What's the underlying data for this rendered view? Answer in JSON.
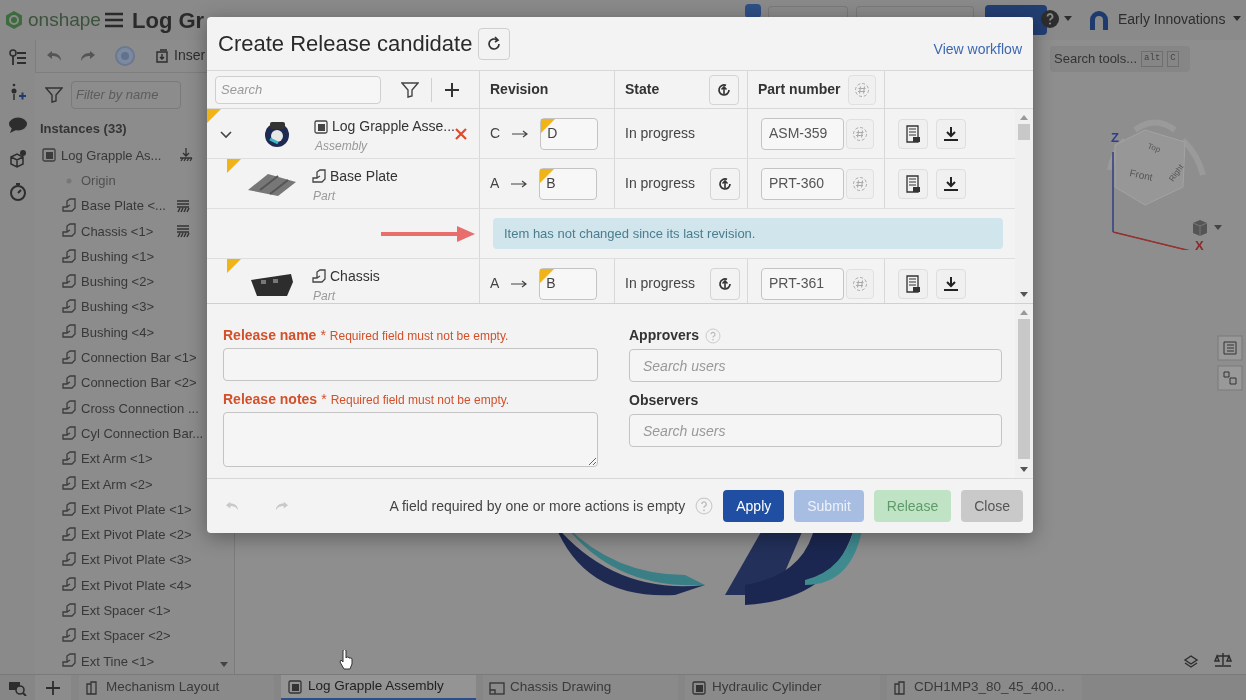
{
  "app": {
    "logo": "onshape",
    "document_title": "Log Gr",
    "user": "Early Innovations"
  },
  "toolbar": {
    "insert_label": "Inser"
  },
  "sidebar": {
    "filter_placeholder": "Filter by name",
    "heading": "Instances (33)",
    "items": [
      {
        "label": "Log Grapple As...",
        "kind": "assembly",
        "fixed": true,
        "children": [
          {
            "label": "Origin",
            "kind": "origin",
            "fixed": false
          },
          {
            "label": "Base Plate <...",
            "kind": "part",
            "fixed": true
          },
          {
            "label": "Chassis <1>",
            "kind": "part",
            "fixed": true
          },
          {
            "label": "Bushing <1>",
            "kind": "part",
            "fixed": false
          },
          {
            "label": "Bushing <2>",
            "kind": "part",
            "fixed": false
          },
          {
            "label": "Bushing <3>",
            "kind": "part",
            "fixed": false
          },
          {
            "label": "Bushing <4>",
            "kind": "part",
            "fixed": false
          },
          {
            "label": "Connection Bar <1>",
            "kind": "part",
            "fixed": false
          },
          {
            "label": "Connection Bar <2>",
            "kind": "part",
            "fixed": false
          },
          {
            "label": "Cross Connection ...",
            "kind": "part",
            "fixed": false
          },
          {
            "label": "Cyl Connection Bar...",
            "kind": "part",
            "fixed": false
          },
          {
            "label": "Ext Arm <1>",
            "kind": "part",
            "fixed": false
          },
          {
            "label": "Ext Arm <2>",
            "kind": "part",
            "fixed": false
          },
          {
            "label": "Ext Pivot Plate <1>",
            "kind": "part",
            "fixed": false
          },
          {
            "label": "Ext Pivot Plate <2>",
            "kind": "part",
            "fixed": false
          },
          {
            "label": "Ext Pivot Plate <3>",
            "kind": "part",
            "fixed": false
          },
          {
            "label": "Ext Pivot Plate <4>",
            "kind": "part",
            "fixed": false
          },
          {
            "label": "Ext Spacer <1>",
            "kind": "part",
            "fixed": false
          },
          {
            "label": "Ext Spacer <2>",
            "kind": "part",
            "fixed": false
          },
          {
            "label": "Ext Tine <1>",
            "kind": "part",
            "fixed": false
          }
        ]
      }
    ]
  },
  "viewport": {
    "search_tools": "Search tools...",
    "shortcut_keys": [
      "alt",
      "C"
    ],
    "viewcube": {
      "top": "Top",
      "front": "Front",
      "right": "Right",
      "z_axis": "Z",
      "x_axis": "X"
    }
  },
  "dialog": {
    "title": "Create Release candidate",
    "view_workflow": "View workflow",
    "search_placeholder": "Search",
    "columns": [
      "Revision",
      "State",
      "Part number"
    ],
    "rows": [
      {
        "name": "Log Grapple Asse...",
        "type": "Assembly",
        "kind": "assembly",
        "from": "C",
        "to": "D",
        "state": "In progress",
        "part_number": "ASM-359",
        "expanded": true,
        "removable": true,
        "refresh": false,
        "children": [
          {
            "name": "Base Plate",
            "type": "Part",
            "kind": "plate",
            "from": "A",
            "to": "B",
            "state": "In progress",
            "part_number": "PRT-360",
            "removable": false,
            "refresh": true,
            "notice": "Item has not changed since its last revision."
          },
          {
            "name": "Chassis",
            "type": "Part",
            "kind": "bracket",
            "from": "A",
            "to": "B",
            "state": "In progress",
            "part_number": "PRT-361",
            "removable": false,
            "refresh": true
          }
        ]
      }
    ],
    "form": {
      "release_name": {
        "label": "Release name",
        "required": "*",
        "error": "Required field must not be empty."
      },
      "release_notes": {
        "label": "Release notes",
        "required": "*",
        "error": "Required field must not be empty."
      },
      "approvers": {
        "label": "Approvers",
        "placeholder": "Search users"
      },
      "observers": {
        "label": "Observers",
        "placeholder": "Search users"
      }
    },
    "footer": {
      "message": "A field required by one or more actions is empty",
      "buttons": [
        {
          "label": "Apply",
          "kind": "primary",
          "disabled": false
        },
        {
          "label": "Submit",
          "kind": "primary",
          "disabled": true
        },
        {
          "label": "Release",
          "kind": "success",
          "disabled": true
        },
        {
          "label": "Close",
          "kind": "neutral",
          "disabled": false
        }
      ]
    }
  },
  "tabs": [
    {
      "label": "Mechanism Layout",
      "kind": "sketch",
      "selected": false
    },
    {
      "label": "Log Grapple Assembly",
      "kind": "assembly",
      "selected": true
    },
    {
      "label": "Chassis Drawing",
      "kind": "drawing",
      "selected": false
    },
    {
      "label": "Hydraulic Cylinder",
      "kind": "assembly",
      "selected": false
    },
    {
      "label": "CDH1MP3_80_45_400...",
      "kind": "sketch",
      "selected": false
    }
  ]
}
